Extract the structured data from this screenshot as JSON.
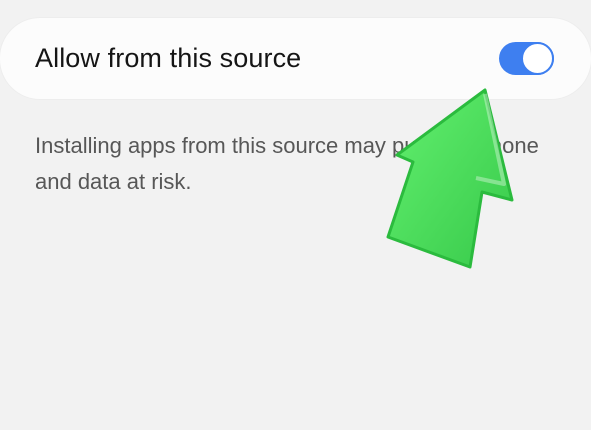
{
  "setting": {
    "label": "Allow from this source",
    "toggle_state": "on",
    "toggle_color": "#3e7ff0"
  },
  "warning": {
    "text": "Installing apps from this source may put your phone and data at risk."
  },
  "overlay": {
    "icon": "up-arrow-icon",
    "color": "#4ddc5c"
  }
}
